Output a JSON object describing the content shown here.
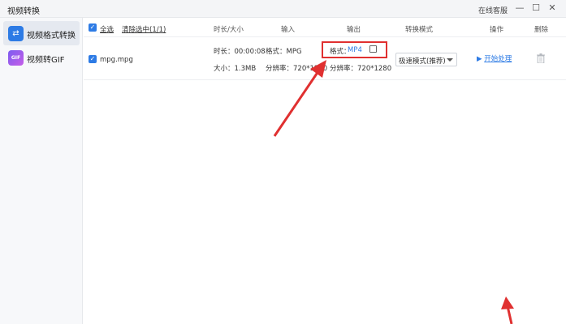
{
  "window": {
    "title": "视频转换",
    "service_label": "在线客服",
    "minimize_icon": "minimize-icon",
    "maximize_icon": "maximize-icon",
    "close_icon": "close-icon"
  },
  "sidebar": {
    "items": [
      {
        "label": "视频格式转换",
        "icon": "convert-arrows-icon",
        "active": true
      },
      {
        "label": "视频转GIF",
        "icon": "gif-icon",
        "active": false
      }
    ]
  },
  "table": {
    "select_all": "全选",
    "clear_selected": "清除选中(1/1)",
    "columns": {
      "duration_size": "时长/大小",
      "input": "输入",
      "output": "输出",
      "mode": "转换模式",
      "action": "操作",
      "delete": "删除"
    },
    "rows": [
      {
        "checked": true,
        "filename": "mpg.mpg",
        "duration": "时长：00:00:08",
        "size": "大小：1.3MB",
        "input_format": "格式：MPG",
        "input_resolution": "分辨率：720*1280",
        "output_format_label": "格式：",
        "output_format_value": "MP4",
        "output_resolution": "分辨率：720*1280",
        "mode": "极速模式(推荐)",
        "action": "开始处理"
      }
    ]
  },
  "colors": {
    "accent": "#2d7be5",
    "highlight": "#e03030"
  }
}
